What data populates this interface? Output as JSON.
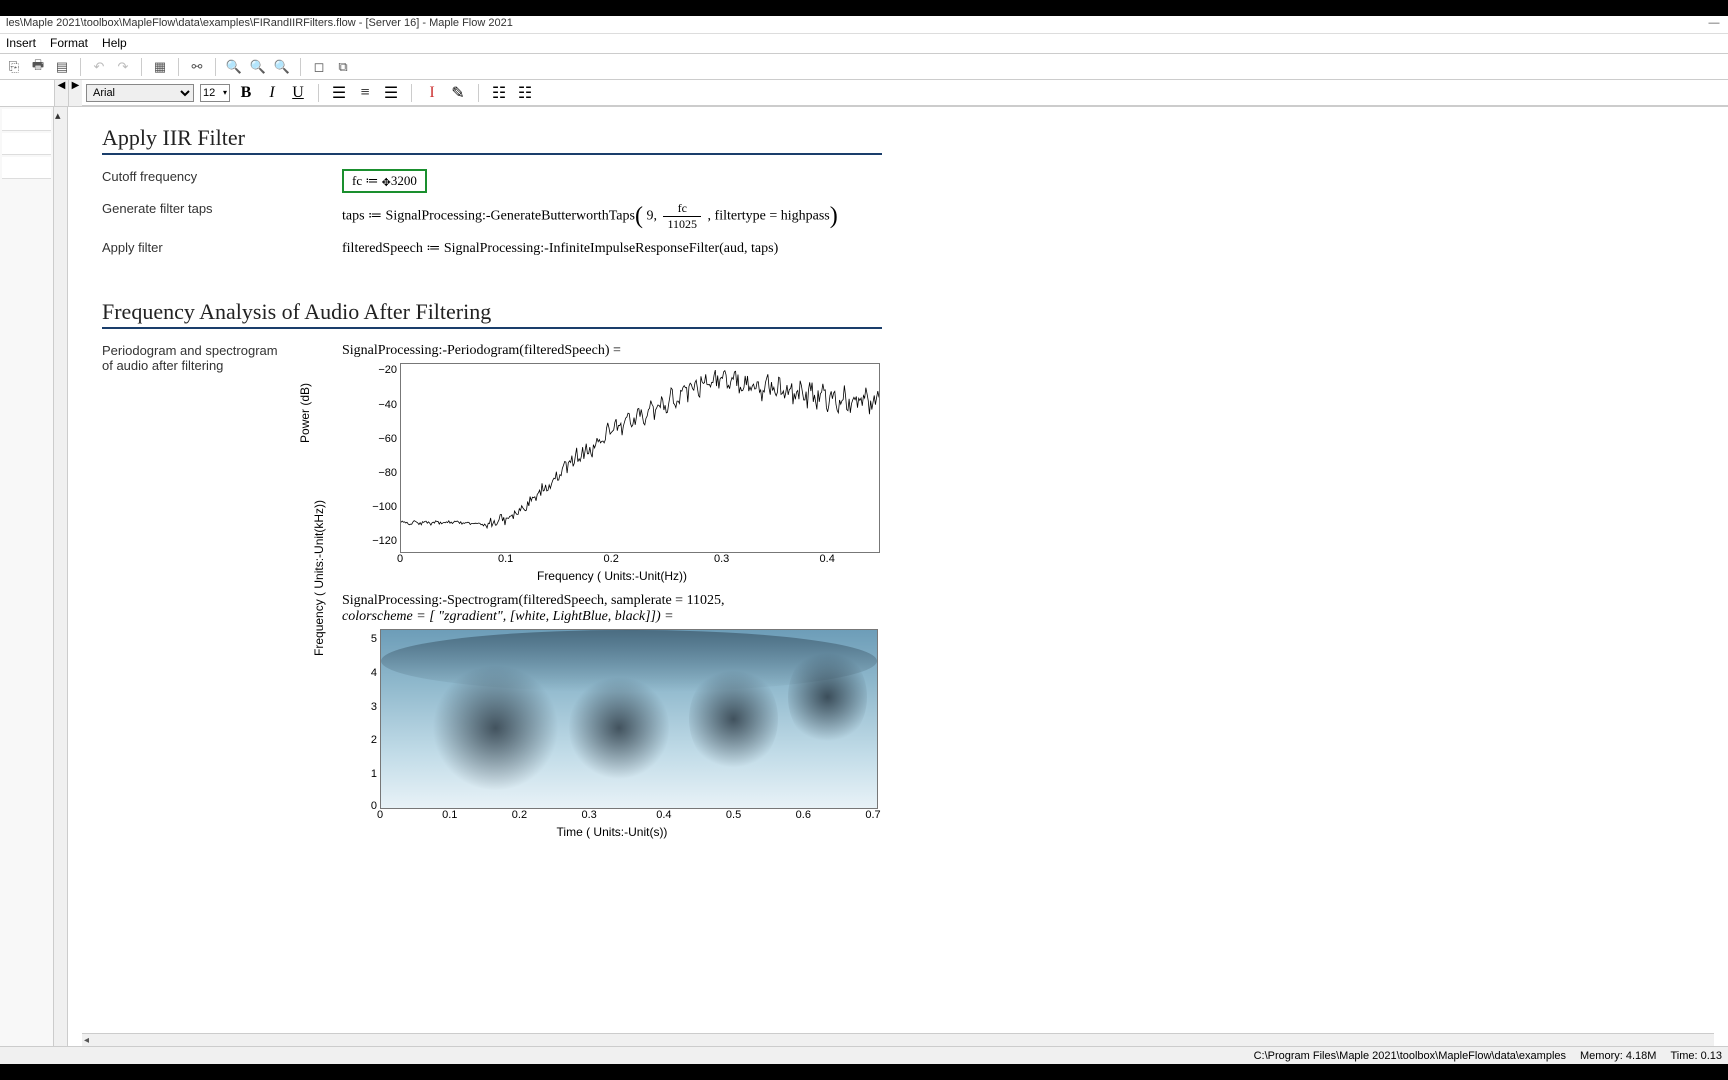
{
  "title": "les\\Maple 2021\\toolbox\\MapleFlow\\data\\examples\\FIRandIIRFilters.flow - [Server 16] - Maple Flow 2021",
  "menus": {
    "insert": "Insert",
    "format": "Format",
    "help": "Help"
  },
  "format_toolbar": {
    "font": "Arial",
    "size": "12"
  },
  "section1": {
    "heading": "Apply IIR Filter",
    "row1_label": "Cutoff frequency",
    "row1_expr_prefix": "fc  ≔  ",
    "row1_expr_value": "3200",
    "row2_label": "Generate filter taps",
    "row2_expr_a": "taps  ≔  SignalProcessing:-GenerateButterworthTaps",
    "row2_arg1": "9,",
    "row2_frac_num": "fc",
    "row2_frac_den": "11025",
    "row2_arg3": ", filtertype = highpass",
    "row3_label": "Apply filter",
    "row3_expr": "filteredSpeech  ≔  SignalProcessing:-InfiniteImpulseResponseFilter(aud, taps)"
  },
  "section2": {
    "heading": "Frequency Analysis of Audio After Filtering",
    "desc1": "Periodogram and spectrogram",
    "desc2": "of audio after filtering",
    "plot1_call": "SignalProcessing:-Periodogram(filteredSpeech) =",
    "plot2_call_l1": "SignalProcessing:-Spectrogram(filteredSpeech, samplerate = 11025,",
    "plot2_call_l2": "colorscheme = [ \"zgradient\", [white, LightBlue, black]]) ="
  },
  "chart_data": [
    {
      "type": "line",
      "name": "periodogram",
      "xlabel": "Frequency  ( Units:-Unit(Hz))",
      "ylabel": "Power (dB)",
      "xlim": [
        0,
        0.45
      ],
      "ylim": [
        -130,
        -15
      ],
      "yticks": [
        -20,
        -40,
        -60,
        -80,
        -100,
        -120
      ],
      "xticks": [
        0,
        0.1,
        0.2,
        0.3,
        0.4
      ],
      "series": [
        {
          "name": "power",
          "x": [
            0.0,
            0.05,
            0.08,
            0.1,
            0.12,
            0.14,
            0.16,
            0.18,
            0.2,
            0.22,
            0.24,
            0.26,
            0.28,
            0.3,
            0.33,
            0.36,
            0.4,
            0.44
          ],
          "values": [
            -112,
            -112,
            -113,
            -110,
            -100,
            -88,
            -75,
            -65,
            -55,
            -48,
            -42,
            -35,
            -28,
            -25,
            -28,
            -33,
            -35,
            -38
          ]
        }
      ]
    },
    {
      "type": "heatmap",
      "name": "spectrogram",
      "xlabel": "Time  ( Units:-Unit(s))",
      "ylabel": "Frequency ( Units:-Unit(kHz))",
      "xlim": [
        0,
        0.75
      ],
      "ylim": [
        0,
        5.5
      ],
      "yticks": [
        0,
        1,
        2,
        3,
        4,
        5
      ],
      "xticks": [
        0,
        0.1,
        0.2,
        0.3,
        0.4,
        0.5,
        0.6,
        0.7
      ],
      "colorscheme": [
        "white",
        "LightBlue",
        "black"
      ]
    }
  ],
  "status": {
    "path": "C:\\Program Files\\Maple 2021\\toolbox\\MapleFlow\\data\\examples",
    "memory": "Memory: 4.18M",
    "time": "Time: 0.13"
  }
}
